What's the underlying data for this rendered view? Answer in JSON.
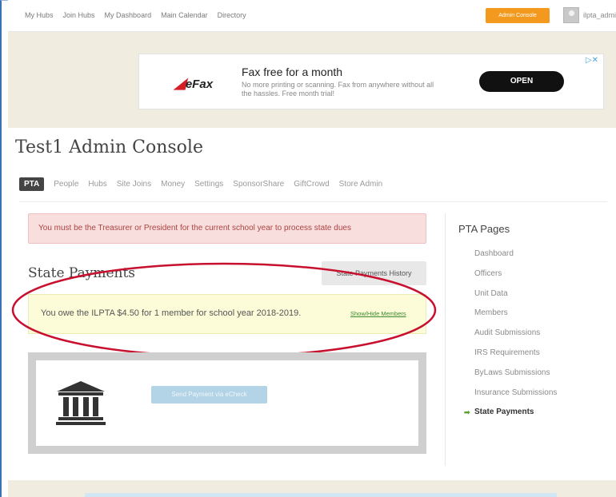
{
  "topnav": {
    "links": [
      "My Hubs",
      "Join Hubs",
      "My Dashboard",
      "Main Calendar",
      "Directory"
    ],
    "admin_badge": "Admin Console",
    "username": "ilpta_admin"
  },
  "ad": {
    "logo": "eFax",
    "title": "Fax free for a month",
    "description": "No more printing or scanning. Fax from anywhere without all the hassles. Free month trial!",
    "cta": "OPEN",
    "marker": "▷✕"
  },
  "page": {
    "title": "Test1 Admin Console"
  },
  "tabs": [
    "PTA",
    "People",
    "Hubs",
    "Site Joins",
    "Money",
    "Settings",
    "SponsorShare",
    "GiftCrowd",
    "Store Admin"
  ],
  "alert": {
    "text": "You must be the Treasurer or President for the current school year to process state dues"
  },
  "state_payments": {
    "title": "State Payments",
    "history_button": "State Payments History",
    "owe_text": "You owe the ILPTA $4.50 for 1 member for school year 2018-2019.",
    "toggle_link": "Show/Hide Members",
    "echeck_button": "Send Payment via eCheck"
  },
  "sidebar": {
    "title": "PTA Pages",
    "items": [
      "Dashboard",
      "Officers",
      "Unit Data",
      "Members",
      "Audit Submissions",
      "IRS Requirements",
      "ByLaws Submissions",
      "Insurance Submissions",
      "State Payments"
    ],
    "current_arrow": "➡"
  },
  "colors": {
    "accent_orange": "#f39a1e",
    "highlight_red": "#c8102e",
    "link_green": "#3c8a2e"
  }
}
